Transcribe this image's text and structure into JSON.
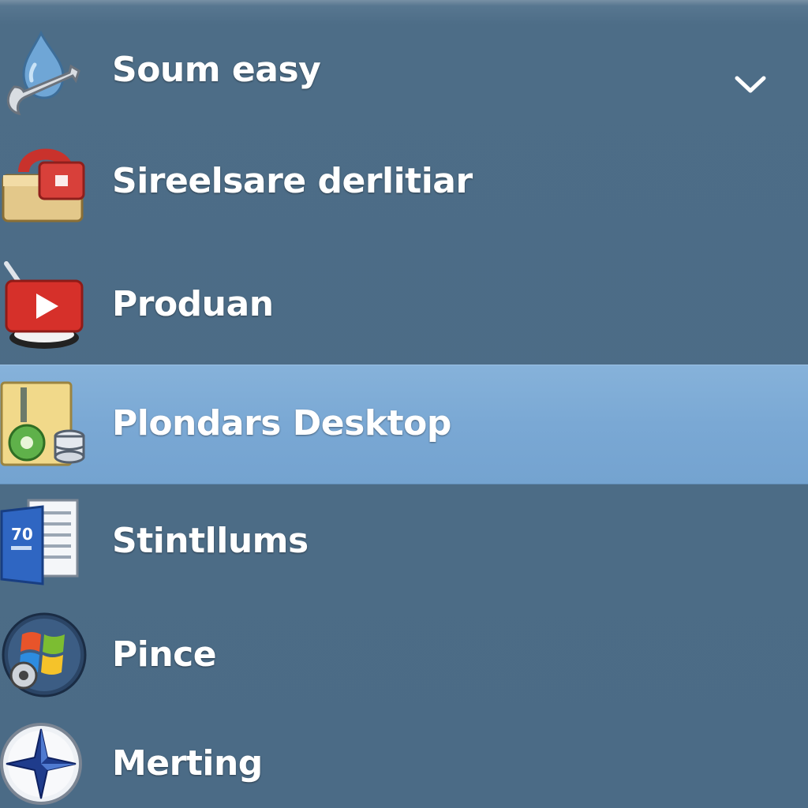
{
  "menu": {
    "items": [
      {
        "label": "Soum easy",
        "icon": "wrench-drop-icon",
        "selected": false
      },
      {
        "label": "Sireelsare derlitiar",
        "icon": "lock-folder-icon",
        "selected": false
      },
      {
        "label": "Produan",
        "icon": "media-player-icon",
        "selected": false
      },
      {
        "label": "Plondars Desktop",
        "icon": "folder-database-icon",
        "selected": true
      },
      {
        "label": "Stintllums",
        "icon": "document-icon",
        "selected": false
      },
      {
        "label": "Pince",
        "icon": "windows-orb-icon",
        "selected": false
      },
      {
        "label": "Merting",
        "icon": "compass-star-icon",
        "selected": false
      }
    ],
    "expand_icon": "chevron-down-icon"
  },
  "colors": {
    "background": "#4b6b86",
    "selected_row": "#7aa8d4",
    "text": "#ffffff"
  }
}
